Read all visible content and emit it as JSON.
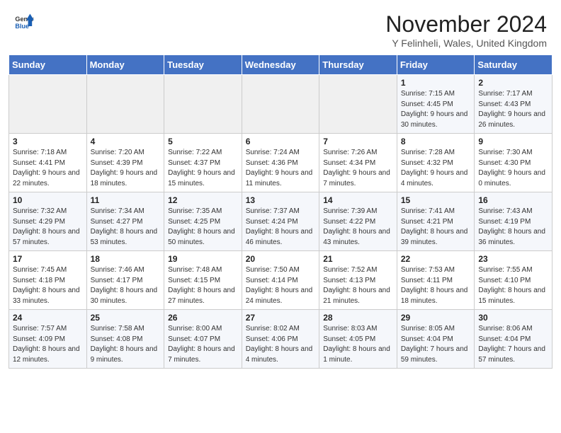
{
  "header": {
    "logo_line1": "General",
    "logo_line2": "Blue",
    "month": "November 2024",
    "location": "Y Felinheli, Wales, United Kingdom"
  },
  "weekdays": [
    "Sunday",
    "Monday",
    "Tuesday",
    "Wednesday",
    "Thursday",
    "Friday",
    "Saturday"
  ],
  "weeks": [
    [
      {
        "day": "",
        "info": ""
      },
      {
        "day": "",
        "info": ""
      },
      {
        "day": "",
        "info": ""
      },
      {
        "day": "",
        "info": ""
      },
      {
        "day": "",
        "info": ""
      },
      {
        "day": "1",
        "info": "Sunrise: 7:15 AM\nSunset: 4:45 PM\nDaylight: 9 hours and 30 minutes."
      },
      {
        "day": "2",
        "info": "Sunrise: 7:17 AM\nSunset: 4:43 PM\nDaylight: 9 hours and 26 minutes."
      }
    ],
    [
      {
        "day": "3",
        "info": "Sunrise: 7:18 AM\nSunset: 4:41 PM\nDaylight: 9 hours and 22 minutes."
      },
      {
        "day": "4",
        "info": "Sunrise: 7:20 AM\nSunset: 4:39 PM\nDaylight: 9 hours and 18 minutes."
      },
      {
        "day": "5",
        "info": "Sunrise: 7:22 AM\nSunset: 4:37 PM\nDaylight: 9 hours and 15 minutes."
      },
      {
        "day": "6",
        "info": "Sunrise: 7:24 AM\nSunset: 4:36 PM\nDaylight: 9 hours and 11 minutes."
      },
      {
        "day": "7",
        "info": "Sunrise: 7:26 AM\nSunset: 4:34 PM\nDaylight: 9 hours and 7 minutes."
      },
      {
        "day": "8",
        "info": "Sunrise: 7:28 AM\nSunset: 4:32 PM\nDaylight: 9 hours and 4 minutes."
      },
      {
        "day": "9",
        "info": "Sunrise: 7:30 AM\nSunset: 4:30 PM\nDaylight: 9 hours and 0 minutes."
      }
    ],
    [
      {
        "day": "10",
        "info": "Sunrise: 7:32 AM\nSunset: 4:29 PM\nDaylight: 8 hours and 57 minutes."
      },
      {
        "day": "11",
        "info": "Sunrise: 7:34 AM\nSunset: 4:27 PM\nDaylight: 8 hours and 53 minutes."
      },
      {
        "day": "12",
        "info": "Sunrise: 7:35 AM\nSunset: 4:25 PM\nDaylight: 8 hours and 50 minutes."
      },
      {
        "day": "13",
        "info": "Sunrise: 7:37 AM\nSunset: 4:24 PM\nDaylight: 8 hours and 46 minutes."
      },
      {
        "day": "14",
        "info": "Sunrise: 7:39 AM\nSunset: 4:22 PM\nDaylight: 8 hours and 43 minutes."
      },
      {
        "day": "15",
        "info": "Sunrise: 7:41 AM\nSunset: 4:21 PM\nDaylight: 8 hours and 39 minutes."
      },
      {
        "day": "16",
        "info": "Sunrise: 7:43 AM\nSunset: 4:19 PM\nDaylight: 8 hours and 36 minutes."
      }
    ],
    [
      {
        "day": "17",
        "info": "Sunrise: 7:45 AM\nSunset: 4:18 PM\nDaylight: 8 hours and 33 minutes."
      },
      {
        "day": "18",
        "info": "Sunrise: 7:46 AM\nSunset: 4:17 PM\nDaylight: 8 hours and 30 minutes."
      },
      {
        "day": "19",
        "info": "Sunrise: 7:48 AM\nSunset: 4:15 PM\nDaylight: 8 hours and 27 minutes."
      },
      {
        "day": "20",
        "info": "Sunrise: 7:50 AM\nSunset: 4:14 PM\nDaylight: 8 hours and 24 minutes."
      },
      {
        "day": "21",
        "info": "Sunrise: 7:52 AM\nSunset: 4:13 PM\nDaylight: 8 hours and 21 minutes."
      },
      {
        "day": "22",
        "info": "Sunrise: 7:53 AM\nSunset: 4:11 PM\nDaylight: 8 hours and 18 minutes."
      },
      {
        "day": "23",
        "info": "Sunrise: 7:55 AM\nSunset: 4:10 PM\nDaylight: 8 hours and 15 minutes."
      }
    ],
    [
      {
        "day": "24",
        "info": "Sunrise: 7:57 AM\nSunset: 4:09 PM\nDaylight: 8 hours and 12 minutes."
      },
      {
        "day": "25",
        "info": "Sunrise: 7:58 AM\nSunset: 4:08 PM\nDaylight: 8 hours and 9 minutes."
      },
      {
        "day": "26",
        "info": "Sunrise: 8:00 AM\nSunset: 4:07 PM\nDaylight: 8 hours and 7 minutes."
      },
      {
        "day": "27",
        "info": "Sunrise: 8:02 AM\nSunset: 4:06 PM\nDaylight: 8 hours and 4 minutes."
      },
      {
        "day": "28",
        "info": "Sunrise: 8:03 AM\nSunset: 4:05 PM\nDaylight: 8 hours and 1 minute."
      },
      {
        "day": "29",
        "info": "Sunrise: 8:05 AM\nSunset: 4:04 PM\nDaylight: 7 hours and 59 minutes."
      },
      {
        "day": "30",
        "info": "Sunrise: 8:06 AM\nSunset: 4:04 PM\nDaylight: 7 hours and 57 minutes."
      }
    ]
  ]
}
